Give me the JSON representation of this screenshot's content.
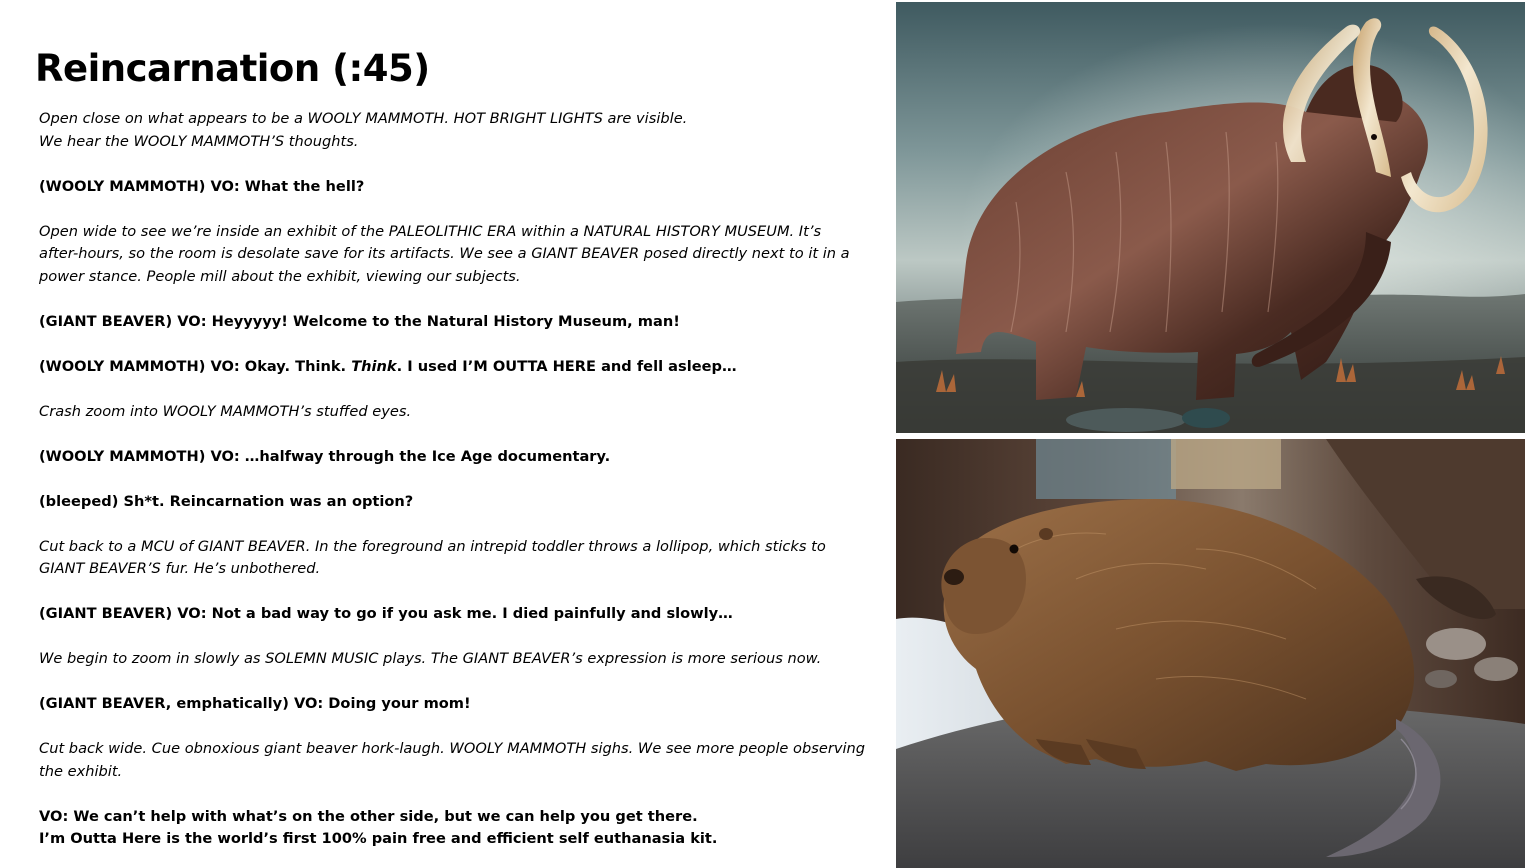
{
  "slide": {
    "title": "Reincarnation (:45)"
  },
  "script": {
    "p1": {
      "line1": "Open close on what appears to be a WOOLY MAMMOTH. HOT BRIGHT LIGHTS are visible.",
      "line2": "We hear the WOOLY MAMMOTH’S thoughts."
    },
    "p2": "(WOOLY MAMMOTH) VO: What the hell?",
    "p3": {
      "line1": "Open wide to see we’re inside an exhibit of the PALEOLITHIC ERA within a NATURAL HISTORY MUSEUM. It’s",
      "line2": "after-hours, so the room is desolate save for its artifacts. We see a GIANT BEAVER posed directly next to it in a",
      "line3": "power stance. People mill about the exhibit, viewing our subjects."
    },
    "p4": "(GIANT BEAVER) VO: Heyyyyy! Welcome to the Natural History Museum, man!",
    "p5": {
      "before": "(WOOLY MAMMOTH)  VO: Okay. Think. ",
      "emphasis": "Think",
      "after": ". I used I’M OUTTA HERE and fell asleep…"
    },
    "p6": "Crash zoom into WOOLY MAMMOTH’s stuffed eyes.",
    "p7": "(WOOLY MAMMOTH) VO: …halfway through the Ice Age documentary.",
    "p8": "(bleeped) Sh*t. Reincarnation was an option?",
    "p9": {
      "line1": "Cut back to a MCU of GIANT BEAVER. In the foreground an intrepid toddler throws a lollipop, which sticks to",
      "line2": "GIANT BEAVER’S fur. He’s unbothered."
    },
    "p10": "(GIANT BEAVER) VO: Not a bad way to go if you ask me. I died painfully and slowly…",
    "p11": "We begin to zoom in slowly as SOLEMN MUSIC plays. The GIANT BEAVER’s expression is more serious now.",
    "p12": "(GIANT BEAVER, emphatically)  VO:  Doing your mom!",
    "p13": {
      "line1": "Cut back wide. Cue obnoxious giant beaver hork-laugh. WOOLY MAMMOTH sighs. We see more people observing",
      "line2": "the exhibit."
    },
    "p14": {
      "line1": "VO: We can’t help with what’s on the other side, but we can help you get there.",
      "line2": "I’m Outta Here is the world’s first 100% pain free and efficient self euthanasia kit."
    }
  },
  "images": {
    "top": "wooly-mammoth-photo",
    "bottom": "giant-beaver-photo"
  }
}
